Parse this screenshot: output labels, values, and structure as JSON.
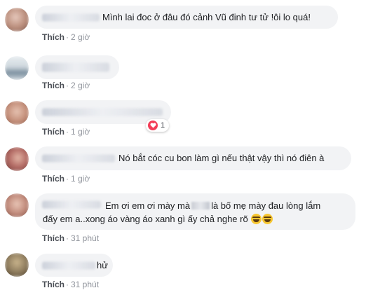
{
  "comments": [
    {
      "text": "Mình lai đoc ở đâu đó cảnh Vũ đinh tư tử !ôi lo quá!",
      "like": "Thích",
      "time": "2 giờ",
      "avatar_colors": [
        "#b98c7a",
        "#e7c9bd",
        "#7b5a52"
      ]
    },
    {
      "text": "",
      "like": "Thích",
      "time": "2 giờ",
      "avatar_colors": [
        "#cfd8de",
        "#7b8f9e",
        "#e9eef1"
      ]
    },
    {
      "text": "",
      "like": "Thích",
      "time": "1 giờ",
      "reaction_count": "1",
      "avatar_colors": [
        "#c48f7a",
        "#e6c3b2",
        "#8a5a49"
      ]
    },
    {
      "text": "Nó bắt cóc cu bon làm gì nếu thật vậy thì nó điên à",
      "like": "Thích",
      "time": "1 giờ",
      "avatar_colors": [
        "#b36a64",
        "#e2b5a5",
        "#6d3c36"
      ]
    },
    {
      "text_line1_a": "Em ơi em ơi mày mà",
      "text_line1_b": "là bố mẹ mày đau lòng lắm",
      "text_line2": "đấy em a..xong áo vàng áo xanh gì ấy chả nghe rõ",
      "like": "Thích",
      "time": "31 phút",
      "avatar_colors": [
        "#c0897a",
        "#e9c6b6",
        "#7d4f43"
      ]
    },
    {
      "text": "hử",
      "like": "Thích",
      "time": "31 phút",
      "avatar_colors": [
        "#8c7a5c",
        "#c9b48c",
        "#4a3d2a"
      ]
    }
  ]
}
